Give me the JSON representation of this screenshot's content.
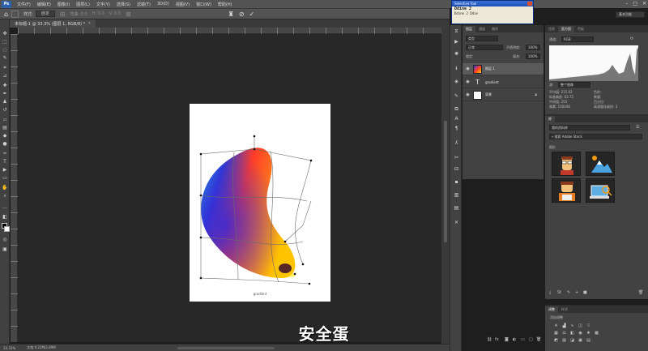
{
  "menubar": {
    "logo": "Ps",
    "items": [
      "文件(F)",
      "编辑(E)",
      "图像(I)",
      "图层(L)",
      "文字(Y)",
      "选择(S)",
      "滤镜(T)",
      "3D(D)",
      "视图(V)",
      "窗口(W)",
      "帮助(H)"
    ]
  },
  "options": {
    "style_label": "样式:",
    "style_value": "自定",
    "bend": "弯曲: 0.0",
    "h": "H: 0.0",
    "v": "V: 0.0"
  },
  "document": {
    "tab_title": "未标题-1 @ 33.3% (图层 1, RGB/8) *",
    "caption": "gradient"
  },
  "status": {
    "zoom": "33.33%",
    "doc_size": "文档:4.22M/2.89M"
  },
  "subtitle": "安全蛋",
  "selective_tool": {
    "title": "Selective Tool",
    "line1": "Ddine 2",
    "line2": "Ddine 2        Ddie"
  },
  "workspace": "基本功能",
  "layers_panel": {
    "tabs": [
      "图层",
      "通道",
      "路径"
    ],
    "filter_placeholder": "类型",
    "blend_mode": "正常",
    "opacity_label": "不透明度:",
    "opacity_value": "100%",
    "lock_label": "锁定:",
    "fill_label": "填充:",
    "fill_value": "100%",
    "layers": [
      {
        "name": "图层 1",
        "type": "image",
        "selected": true
      },
      {
        "name": "gradient",
        "type": "text",
        "selected": false
      },
      {
        "name": "背景",
        "type": "background",
        "selected": false
      }
    ]
  },
  "histogram_panel": {
    "tabs": [
      "信息",
      "直方图",
      "色板"
    ],
    "channel_label": "通道:",
    "channel_value": "RGB",
    "source_label": "源:",
    "source_value": "整个图像",
    "stats": [
      [
        "平均值:",
        "215.02"
      ],
      [
        "标准偏差:",
        "63.75"
      ],
      [
        "中间值:",
        "255"
      ],
      [
        "像素:",
        "100446"
      ]
    ],
    "stats_right": [
      "色阶:",
      "数量:",
      "百分位:",
      "高速缓存级别: 3"
    ]
  },
  "libraries_panel": {
    "header": "库",
    "library_name": "我的资料库",
    "search_placeholder": "搜索 Adobe Stock",
    "section": "图形"
  },
  "adjust_panel": {
    "tabs": [
      "调整",
      "样式"
    ],
    "title": "添加调整"
  },
  "colors": {
    "panel_bg": "#424242",
    "menubar_bg": "#535353",
    "workspace_bg": "#282828",
    "accent_blue": "#2c63a8"
  }
}
